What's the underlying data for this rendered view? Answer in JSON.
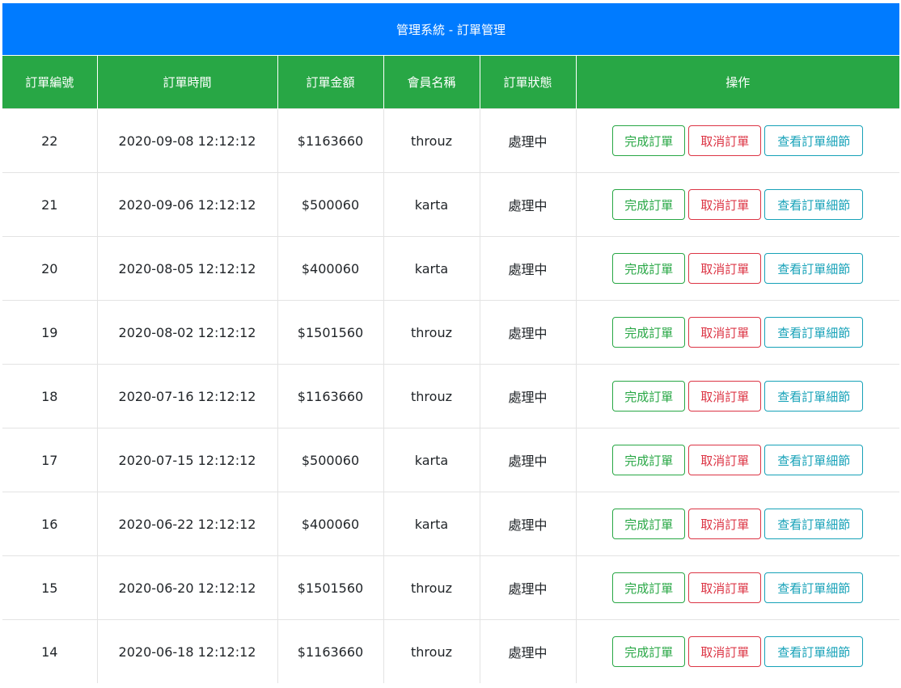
{
  "header": {
    "title": "管理系統 - 訂單管理"
  },
  "table": {
    "columns": [
      "訂單編號",
      "訂單時間",
      "訂單金額",
      "會員名稱",
      "訂單狀態",
      "操作"
    ],
    "action_labels": {
      "complete": "完成訂單",
      "cancel": "取消訂單",
      "details": "查看訂單細節"
    },
    "rows": [
      {
        "id": "22",
        "time": "2020-09-08 12:12:12",
        "amount": "$1163660",
        "member": "throuz",
        "status": "處理中"
      },
      {
        "id": "21",
        "time": "2020-09-06 12:12:12",
        "amount": "$500060",
        "member": "karta",
        "status": "處理中"
      },
      {
        "id": "20",
        "time": "2020-08-05 12:12:12",
        "amount": "$400060",
        "member": "karta",
        "status": "處理中"
      },
      {
        "id": "19",
        "time": "2020-08-02 12:12:12",
        "amount": "$1501560",
        "member": "throuz",
        "status": "處理中"
      },
      {
        "id": "18",
        "time": "2020-07-16 12:12:12",
        "amount": "$1163660",
        "member": "throuz",
        "status": "處理中"
      },
      {
        "id": "17",
        "time": "2020-07-15 12:12:12",
        "amount": "$500060",
        "member": "karta",
        "status": "處理中"
      },
      {
        "id": "16",
        "time": "2020-06-22 12:12:12",
        "amount": "$400060",
        "member": "karta",
        "status": "處理中"
      },
      {
        "id": "15",
        "time": "2020-06-20 12:12:12",
        "amount": "$1501560",
        "member": "throuz",
        "status": "處理中"
      },
      {
        "id": "14",
        "time": "2020-06-18 12:12:12",
        "amount": "$1163660",
        "member": "throuz",
        "status": "處理中"
      }
    ]
  },
  "colors": {
    "header_blue": "#007bff",
    "table_head_green": "#28a745",
    "success": "#28a745",
    "danger": "#dc3545",
    "info": "#17a2b8"
  }
}
